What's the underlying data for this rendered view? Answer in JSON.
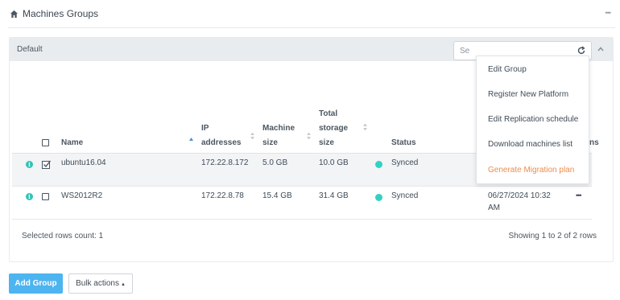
{
  "page": {
    "title": "Machines Groups",
    "menu_icon": "ellipsis-icon"
  },
  "group": {
    "name": "Default",
    "badge": "default",
    "collapse_icon": "chevron-up-icon"
  },
  "search": {
    "placeholder": "Se"
  },
  "table": {
    "columns": [
      {
        "key": "name",
        "label": "Name"
      },
      {
        "key": "ip",
        "label": "IP addresses"
      },
      {
        "key": "machine_size",
        "label": "Machine size"
      },
      {
        "key": "total_storage",
        "label": "Total storage size"
      },
      {
        "key": "status",
        "label": "Status"
      },
      {
        "key": "actions",
        "label": "ns"
      }
    ],
    "rows": [
      {
        "name": "ubuntu16.04",
        "ip": "172.22.8.172",
        "machine_size": "5.0 GB",
        "total_storage": "10.0 GB",
        "status": "Synced",
        "date_line1": "",
        "date_line2": "",
        "checked": true
      },
      {
        "name": "WS2012R2",
        "ip": "172.22.8.78",
        "machine_size": "15.4 GB",
        "total_storage": "31.4 GB",
        "status": "Synced",
        "date_line1": "06/27/2024 10:32",
        "date_line2": "AM",
        "checked": false
      }
    ]
  },
  "footer": {
    "selected_count": "Selected rows count: 1",
    "showing": "Showing 1 to 2 of 2 rows"
  },
  "buttons": {
    "add_group": "Add Group",
    "bulk_actions": "Bulk actions"
  },
  "dropdown_menu": {
    "items": [
      "Edit Group",
      "Register New Platform",
      "Edit Replication schedule",
      "Download machines list",
      "Generate Migration plan"
    ]
  },
  "colors": {
    "accent_blue": "#4db4f0",
    "status_synced": "#33d1c3",
    "highlight_orange": "#f08a4b",
    "header_bg": "#e9ecef"
  }
}
